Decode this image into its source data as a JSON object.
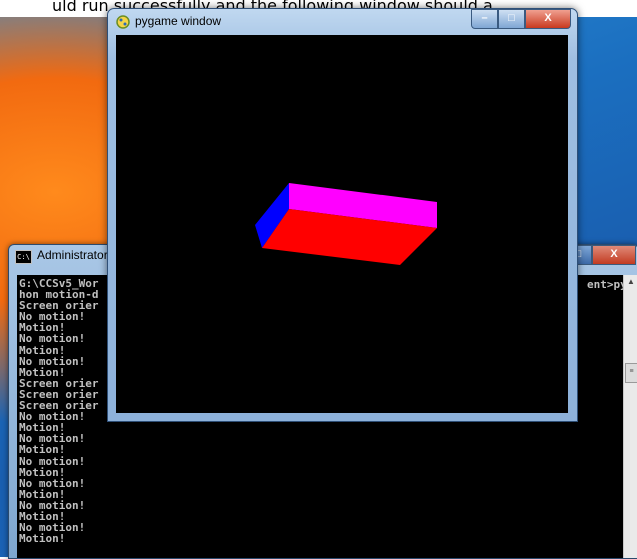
{
  "caption": {
    "text": "uld run successfully and the following window should a"
  },
  "console": {
    "title": "Administrator",
    "max_glyph": "□",
    "close_glyph": "X",
    "lines": [
      "G:\\CCSv5_Wor",
      "hon motion-d",
      "Screen orier",
      "No motion!",
      "Motion!",
      "No motion!",
      "Motion!",
      "No motion!",
      "Motion!",
      "Screen orier",
      "Screen orier",
      "Screen orier",
      "No motion!",
      "Motion!",
      "No motion!",
      "Motion!",
      "No motion!",
      "Motion!",
      "No motion!",
      "Motion!",
      "No motion!",
      "Motion!",
      "No motion!",
      "Motion!"
    ],
    "right_text": "ent>pyt",
    "scroll_thumb_glyph": "≡"
  },
  "pygame": {
    "title": "pygame window",
    "min_glyph": "–",
    "max_glyph": "□",
    "close_glyph": "X"
  },
  "colors": {
    "box_top": "#ff00ff",
    "box_front": "#ff0000",
    "box_side": "#0000ff",
    "canvas_bg": "#000000"
  }
}
